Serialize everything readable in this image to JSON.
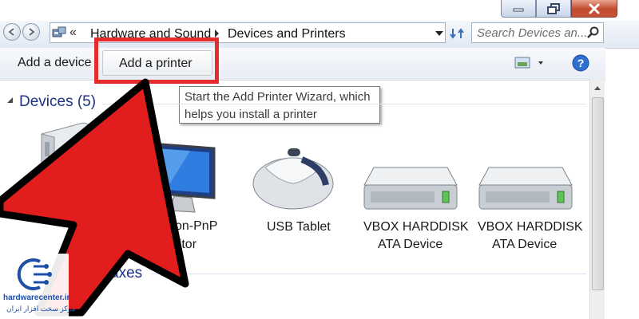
{
  "window": {
    "minimize_icon": "minimize-icon",
    "maximize_icon": "restore-icon",
    "close_icon": "close-icon"
  },
  "address_bar": {
    "overflow_glyph": "«",
    "breadcrumbs": [
      "Hardware and Sound",
      "Devices and Printers"
    ],
    "search_placeholder": "Search Devices an..."
  },
  "toolbar": {
    "add_device": "Add a device",
    "add_printer": "Add a printer"
  },
  "tooltip": {
    "line1": "Start the Add Printer Wizard, which",
    "line2": "helps you install a printer"
  },
  "devices_group": {
    "title": "Devices (5)",
    "items": [
      {
        "line1": "",
        "line2": ""
      },
      {
        "line1": "c Non-PnP",
        "line2": "onitor"
      },
      {
        "line1": "USB Tablet",
        "line2": ""
      },
      {
        "line1": "VBOX HARDDISK",
        "line2": "ATA Device"
      },
      {
        "line1": "VBOX HARDDISK",
        "line2": "ATA Device"
      }
    ]
  },
  "second_group": {
    "title_fragment": "axes"
  },
  "watermark": {
    "site": "hardwarecenter.ir",
    "tagline": "مرکز سخت افزار ایران"
  },
  "colors": {
    "highlight_box": "#e52d2d",
    "arrow_fill": "#e11d1d",
    "arrow_outline": "#000000",
    "group_title": "#1e3287",
    "watermark_blue": "#1e4fa8"
  }
}
